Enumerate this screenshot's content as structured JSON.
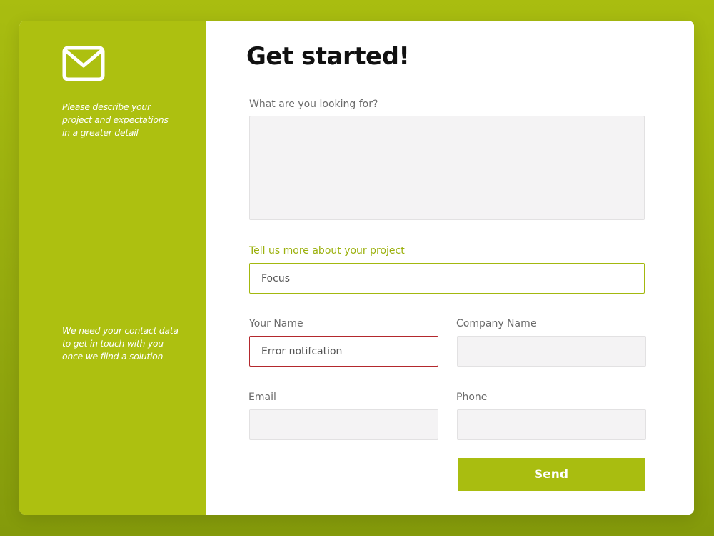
{
  "sidebar": {
    "text_one": "Please describe your\nproject and expectations\nin a greater detail",
    "text_two": "We need your contact data\nto get in touch with you\nonce we fiind a solution",
    "icon": "mail-icon"
  },
  "form": {
    "title": "Get started!",
    "looking_for": {
      "label": "What are you looking for?",
      "value": ""
    },
    "project": {
      "label": "Tell us more about your project",
      "value": "Focus"
    },
    "your_name": {
      "label": "Your Name",
      "value": "Error notifcation"
    },
    "company": {
      "label": "Company Name",
      "value": ""
    },
    "email": {
      "label": "Email",
      "value": ""
    },
    "phone": {
      "label": "Phone",
      "value": ""
    },
    "send_label": "Send"
  },
  "colors": {
    "accent": "#adc010",
    "error": "#b3282d",
    "field_bg": "#f4f3f4"
  }
}
